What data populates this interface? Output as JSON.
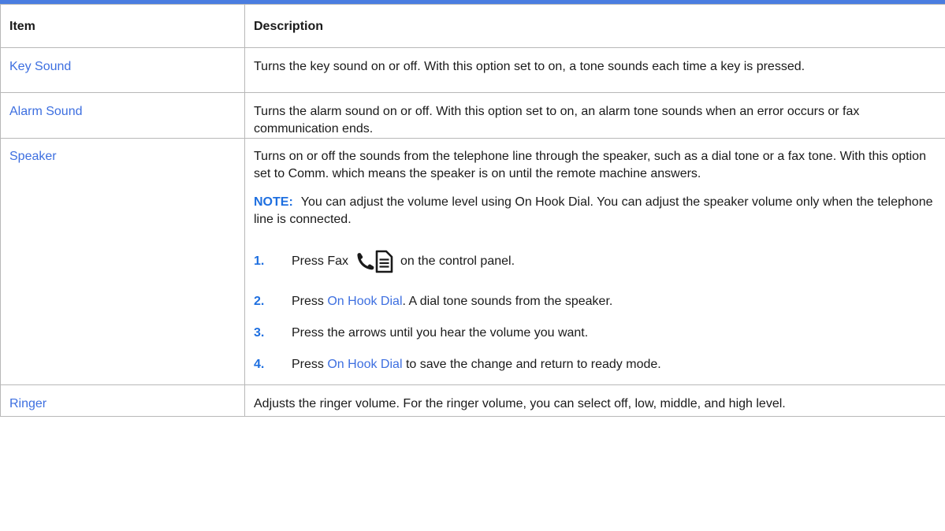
{
  "table": {
    "headers": {
      "item": "Item",
      "description": "Description"
    },
    "rows": [
      {
        "item": "Key Sound",
        "description": "Turns the key sound on or off. With this option set to on, a tone sounds each time a key is pressed."
      },
      {
        "item": "Alarm Sound",
        "description": "Turns the alarm sound on or off. With this option set to on, an alarm tone sounds when an error occurs or fax communication ends."
      },
      {
        "item": "Speaker",
        "description": "Turns on or off the sounds from the telephone line through the speaker, such as a dial tone or a fax tone. With this option set to Comm. which means the speaker is on until the remote machine answers.",
        "note_label": "NOTE:",
        "note_text": "You can adjust the volume level using On Hook Dial. You can adjust the speaker volume only when the telephone line is connected.",
        "steps": [
          {
            "num": "1.",
            "before": "Press Fax",
            "after": "on the control panel.",
            "icon": "fax-icon"
          },
          {
            "num": "2.",
            "before": "Press ",
            "link": "On Hook Dial",
            "after": ". A dial tone sounds from the speaker."
          },
          {
            "num": "3.",
            "text": "Press the arrows until you hear the volume you want."
          },
          {
            "num": "4.",
            "before": "Press ",
            "link": "On Hook Dial",
            "after": " to save the change and return to ready mode."
          }
        ]
      },
      {
        "item": "Ringer",
        "description": "Adjusts the ringer volume. For the ringer volume, you can select off, low, middle, and high level."
      }
    ]
  },
  "colors": {
    "accent_rule": "#4a7de0",
    "link": "#3d6fe0",
    "step_number": "#1e6fe0",
    "border": "#b8b8b8"
  }
}
